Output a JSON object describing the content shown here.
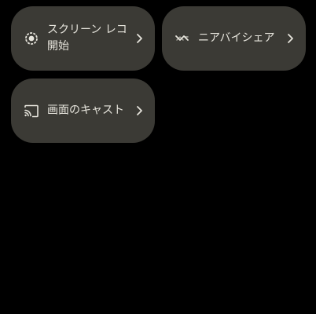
{
  "tiles": {
    "screen_record": {
      "line1": "スクリーン レコ",
      "line2": "開始",
      "icon": "screen-record-icon"
    },
    "nearby_share": {
      "label": "ニアバイシェア",
      "icon": "nearby-share-icon"
    },
    "cast": {
      "label": "画面のキャスト",
      "icon": "cast-icon"
    }
  },
  "colors": {
    "background": "#000000",
    "tile": "#3b3a35",
    "text": "#e6e4dc"
  }
}
